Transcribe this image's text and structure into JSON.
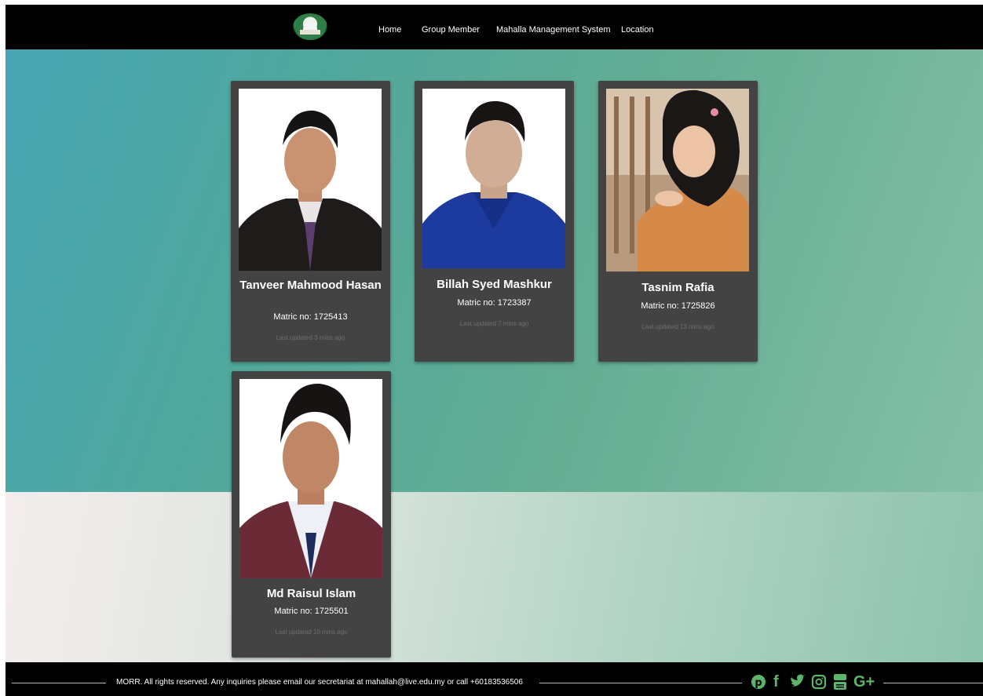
{
  "nav": {
    "logo_icon": "mosque-logo-icon",
    "links": [
      "Home",
      "Group Member",
      "Mahalla Management System",
      "Location"
    ]
  },
  "members": [
    {
      "name": "Tanveer Mahmood Hasan",
      "matric": "Matric no: 1725413",
      "updated": "Last updated 3 mins ago"
    },
    {
      "name": "Billah Syed Mashkur",
      "matric": "Matric no: 1723387",
      "updated": "Last updated 7 mins ago"
    },
    {
      "name": "Tasnim Rafia",
      "matric": "Matric no: 1725826",
      "updated": "Last updated 13 mins ago"
    },
    {
      "name": "Md Raisul Islam",
      "matric": "Matric no: 1725501",
      "updated": "Last updated 10 mins ago"
    }
  ],
  "footer": {
    "text": "MORR. All rights reserved. Any inquiries please email our secretariat at mahallah@live.edu.my or call +60183536506",
    "social_icons": [
      "pinterest-icon",
      "facebook-icon",
      "twitter-icon",
      "instagram-icon",
      "youtube-icon",
      "google-plus-icon"
    ],
    "icon_color": "#5cb56a"
  },
  "colors": {
    "nav_bg": "#000000",
    "card_bg": "#434343"
  }
}
